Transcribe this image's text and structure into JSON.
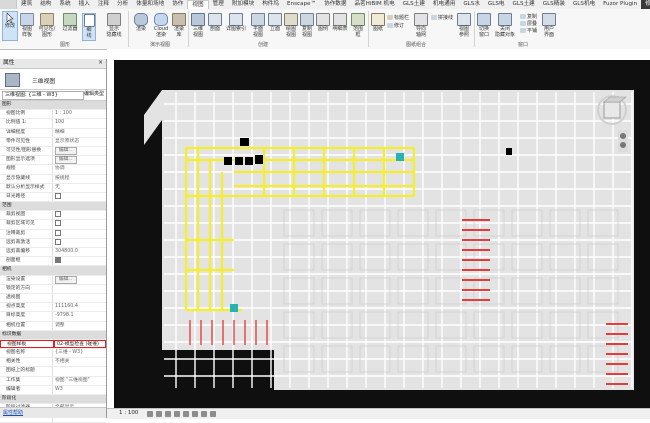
{
  "ribbon_tabs": [
    {
      "label": "建筑",
      "active": false
    },
    {
      "label": "结构",
      "active": false
    },
    {
      "label": "系统",
      "active": false
    },
    {
      "label": "插入",
      "active": false
    },
    {
      "label": "注释",
      "active": false
    },
    {
      "label": "分析",
      "active": false
    },
    {
      "label": "体量和场地",
      "active": false
    },
    {
      "label": "协作",
      "active": false
    },
    {
      "label": "视图",
      "active": true
    },
    {
      "label": "管理",
      "active": false
    },
    {
      "label": "附加模块",
      "active": false
    },
    {
      "label": "构件坞",
      "active": false
    },
    {
      "label": "Enscape™",
      "active": false
    },
    {
      "label": "协作数据",
      "active": false
    },
    {
      "label": "品茗HiBIM 机电",
      "active": false
    },
    {
      "label": "GLS土建",
      "active": false
    },
    {
      "label": "机电通用",
      "active": false
    },
    {
      "label": "GLS水",
      "active": false
    },
    {
      "label": "GLS电",
      "active": false
    },
    {
      "label": "GLS土建",
      "active": false
    },
    {
      "label": "GLS精装",
      "active": false
    },
    {
      "label": "GLS机电",
      "active": false
    },
    {
      "label": "Fuzor Plugin",
      "active": false
    },
    {
      "label": "修",
      "active": false
    }
  ],
  "ribbon": {
    "tools": {
      "modify": "修改",
      "view_template": "视图\n样板",
      "visibility_graphics": "可见性/\n图形",
      "filters": "过滤器",
      "thin_lines": "细\n线",
      "show_hidden": "显示\n隐藏线",
      "render": "渲染",
      "cloud": "Cloud\n渲染",
      "render_gallery": "渲染\n库",
      "three_d": "三维\n视图",
      "section": "剖面",
      "detail_callout": "详图索引",
      "plan_views": "平面\n视图",
      "elevation": "立面",
      "drafting": "绘图\n视图",
      "duplicate_view": "复制\n视图",
      "legends": "图例",
      "schedules": "明细表",
      "scope_box": "范围\n框",
      "sheet": "图纸",
      "title_block": "标题栏",
      "revisions": "修订",
      "guide_grid": "导向\n轴网",
      "matchline": "拼接线",
      "view_reference": "视图\n参照",
      "switch_windows": "切换\n窗口",
      "close_hidden": "关闭\n隐藏对象",
      "replicate": "复制",
      "cascade": "层叠",
      "tile": "平铺",
      "user_interface": "用户\n界面"
    },
    "panels": {
      "graphics": "图形",
      "presentation": "演示视图",
      "create": "创建",
      "sheet_composition": "图纸组合",
      "windows": "窗口"
    }
  },
  "properties": {
    "title": "属性",
    "type_name": "三维视图",
    "view_selector": "三维视图: {三维 - W3}",
    "edit_type": "编辑类型",
    "rows": [
      {
        "kind": "group",
        "label": "图形"
      },
      {
        "label": "视图比例",
        "value": "1 : 100"
      },
      {
        "label": "比例值 1:",
        "value": "100"
      },
      {
        "label": "详细程度",
        "value": "精细"
      },
      {
        "label": "零件可见性",
        "value": "显示原状态"
      },
      {
        "label": "可见性/图形替换",
        "value": "编辑...",
        "button": true
      },
      {
        "label": "图形显示选项",
        "value": "编辑...",
        "button": true
      },
      {
        "label": "规程",
        "value": "协调"
      },
      {
        "label": "显示隐藏线",
        "value": "按规程"
      },
      {
        "label": "默认分析显示样式",
        "value": "无"
      },
      {
        "label": "日光路径",
        "value": "",
        "checkbox": false
      },
      {
        "kind": "group",
        "label": "范围"
      },
      {
        "label": "裁剪视图",
        "value": "",
        "checkbox": false
      },
      {
        "label": "裁剪区域可见",
        "value": "",
        "checkbox": false
      },
      {
        "label": "注释裁剪",
        "value": "",
        "checkbox": false
      },
      {
        "label": "远剪裁激活",
        "value": "",
        "checkbox": false
      },
      {
        "label": "远剪裁偏移",
        "value": "304800.0"
      },
      {
        "label": "剖面框",
        "value": "",
        "checkbox": true
      },
      {
        "kind": "group",
        "label": "相机"
      },
      {
        "label": "渲染设置",
        "value": "编辑...",
        "button": true
      },
      {
        "label": "锁定的方向",
        "value": ""
      },
      {
        "label": "透视图",
        "value": ""
      },
      {
        "label": "视点高度",
        "value": "111160.4"
      },
      {
        "label": "目标高度",
        "value": "-9798.1"
      },
      {
        "label": "相机位置",
        "value": "调整"
      },
      {
        "kind": "group",
        "label": "标识数据"
      },
      {
        "label": "视图样板",
        "value": "02-模型检查 (碰撞)",
        "highlight": true
      },
      {
        "label": "视图名称",
        "value": "{三维 - W3}"
      },
      {
        "label": "相关性",
        "value": "不相关"
      },
      {
        "label": "图纸上的标题",
        "value": ""
      },
      {
        "label": "工作集",
        "value": "视图 \"三维视图\""
      },
      {
        "label": "编辑者",
        "value": "W3"
      },
      {
        "kind": "group",
        "label": "阶段化"
      },
      {
        "label": "阶段过滤器",
        "value": "全部显示"
      },
      {
        "label": "相位",
        "value": "阶段 1"
      }
    ],
    "help_link": "属性帮助"
  },
  "viewport": {
    "background": "#0f0f0f",
    "floor_color": "#e3e3e3",
    "highlight_yellow": "#f5ee2a",
    "highlight_red": "#e52424",
    "cyan_marker": "#27b3b3"
  },
  "statusbar": {
    "scale": "1 : 100"
  }
}
